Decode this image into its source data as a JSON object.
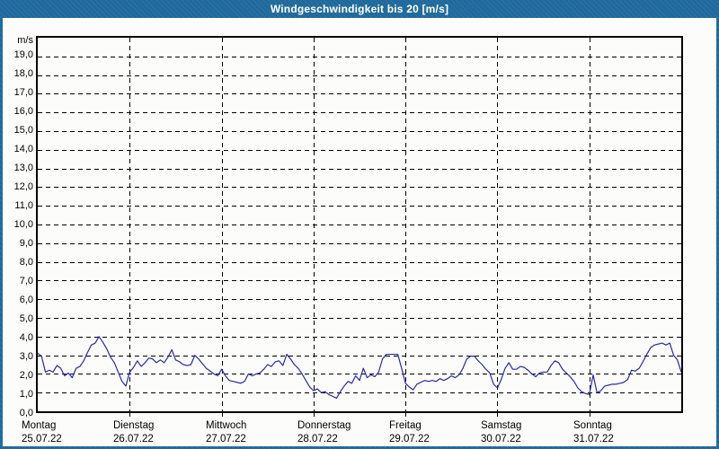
{
  "window": {
    "title": "Windgeschwindigkeit bis 20 [m/s]"
  },
  "colors": {
    "frame_blue": "#20699c",
    "content_background": "#fcfdfa",
    "line_blue": "#2929ac",
    "grid_black": "#000000",
    "title_text": "#ffffff",
    "axis_text": "#000000"
  },
  "chart_data": {
    "type": "line",
    "title": "Windgeschwindigkeit bis 20 [m/s]",
    "unit_label": "m/s",
    "ylabel": "m/s",
    "xlabel": "",
    "ylim": [
      0,
      20
    ],
    "ytick_step": 1.0,
    "grid": true,
    "legend": "none",
    "decimal_separator": ",",
    "ytick_labels": [
      "0,0",
      "1,0",
      "2,0",
      "3,0",
      "4,0",
      "5,0",
      "6,0",
      "7,0",
      "8,0",
      "9,0",
      "10,0",
      "11,0",
      "12,0",
      "13,0",
      "14,0",
      "15,0",
      "16,0",
      "17,0",
      "18,0",
      "19,0"
    ],
    "x_categories": [
      {
        "name": "Montag",
        "date": "25.07.22"
      },
      {
        "name": "Dienstag",
        "date": "26.07.22"
      },
      {
        "name": "Mittwoch",
        "date": "27.07.22"
      },
      {
        "name": "Donnerstag",
        "date": "28.07.22"
      },
      {
        "name": "Freitag",
        "date": "29.07.22"
      },
      {
        "name": "Samstag",
        "date": "30.07.22"
      },
      {
        "name": "Sonntag",
        "date": "31.07.22"
      }
    ],
    "points_per_day": 24,
    "series": [
      {
        "name": "Windgeschwindigkeit [m/s]",
        "color": "#2929ac",
        "values": [
          3.1,
          2.95,
          2.1,
          2.2,
          2.1,
          2.45,
          2.3,
          1.9,
          2.05,
          1.8,
          2.3,
          2.4,
          2.7,
          3.15,
          3.55,
          3.65,
          4.0,
          3.7,
          3.35,
          2.9,
          2.6,
          2.1,
          1.6,
          1.35,
          2.1,
          2.35,
          2.7,
          2.4,
          2.6,
          2.85,
          2.8,
          2.6,
          2.75,
          2.6,
          2.9,
          3.3,
          2.75,
          2.65,
          2.5,
          2.45,
          2.5,
          3.0,
          2.8,
          2.55,
          2.3,
          2.15,
          2.0,
          1.9,
          2.25,
          1.9,
          1.65,
          1.6,
          1.55,
          1.5,
          1.6,
          2.0,
          1.9,
          2.0,
          2.05,
          2.25,
          2.5,
          2.4,
          2.65,
          2.7,
          2.45,
          3.05,
          2.8,
          2.5,
          2.3,
          2.0,
          1.65,
          1.3,
          1.1,
          1.2,
          1.0,
          1.05,
          0.9,
          0.8,
          0.7,
          1.05,
          1.35,
          1.6,
          1.5,
          1.9,
          1.65,
          2.3,
          1.8,
          1.95,
          1.85,
          2.1,
          2.8,
          3.05,
          3.05,
          3.05,
          3.05,
          2.3,
          1.5,
          1.3,
          1.15,
          1.45,
          1.55,
          1.65,
          1.6,
          1.65,
          1.6,
          1.75,
          1.65,
          1.75,
          1.9,
          1.8,
          1.95,
          2.3,
          2.8,
          2.95,
          2.95,
          2.7,
          2.5,
          2.25,
          2.05,
          1.45,
          1.25,
          1.7,
          2.3,
          2.6,
          2.25,
          2.25,
          2.4,
          2.35,
          2.2,
          2.0,
          1.85,
          2.05,
          2.1,
          2.1,
          2.45,
          2.7,
          2.6,
          2.25,
          2.05,
          1.85,
          1.6,
          1.25,
          1.05,
          0.95,
          0.9,
          1.95,
          1.0,
          1.1,
          1.35,
          1.4,
          1.45,
          1.45,
          1.5,
          1.55,
          1.7,
          2.2,
          2.15,
          2.3,
          2.65,
          3.05,
          3.4,
          3.55,
          3.6,
          3.65,
          3.55,
          3.65,
          3.0,
          2.75,
          2.1
        ]
      }
    ]
  }
}
